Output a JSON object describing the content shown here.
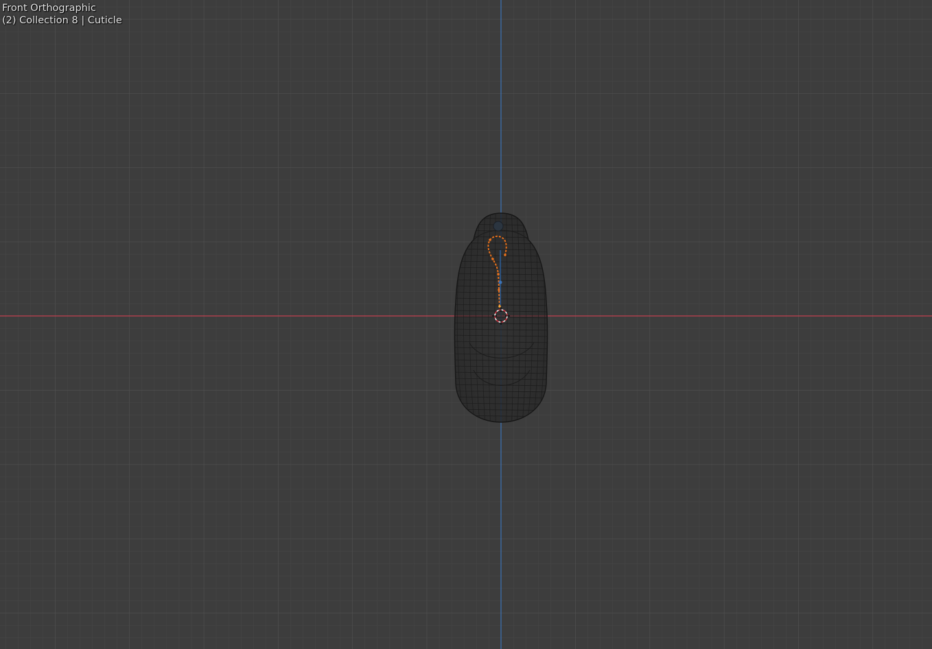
{
  "viewport": {
    "view_name": "Front Orthographic",
    "collection_info": "(2) Collection 8 | Cuticle",
    "shading": "wireframe-xray",
    "active_object": "Cuticle",
    "selected_elements": "armature-chain-orange"
  },
  "colors": {
    "background": "#3d3d3d",
    "grid_minor": "#454545",
    "grid_major": "#4f4f4f",
    "x_axis": "#c2414f",
    "z_axis": "#3b73b8",
    "selection": "#e8711b",
    "wire": "#1a1a1a",
    "cursor": "#ffffff"
  },
  "icons": {
    "cursor": "3d-cursor-icon"
  }
}
